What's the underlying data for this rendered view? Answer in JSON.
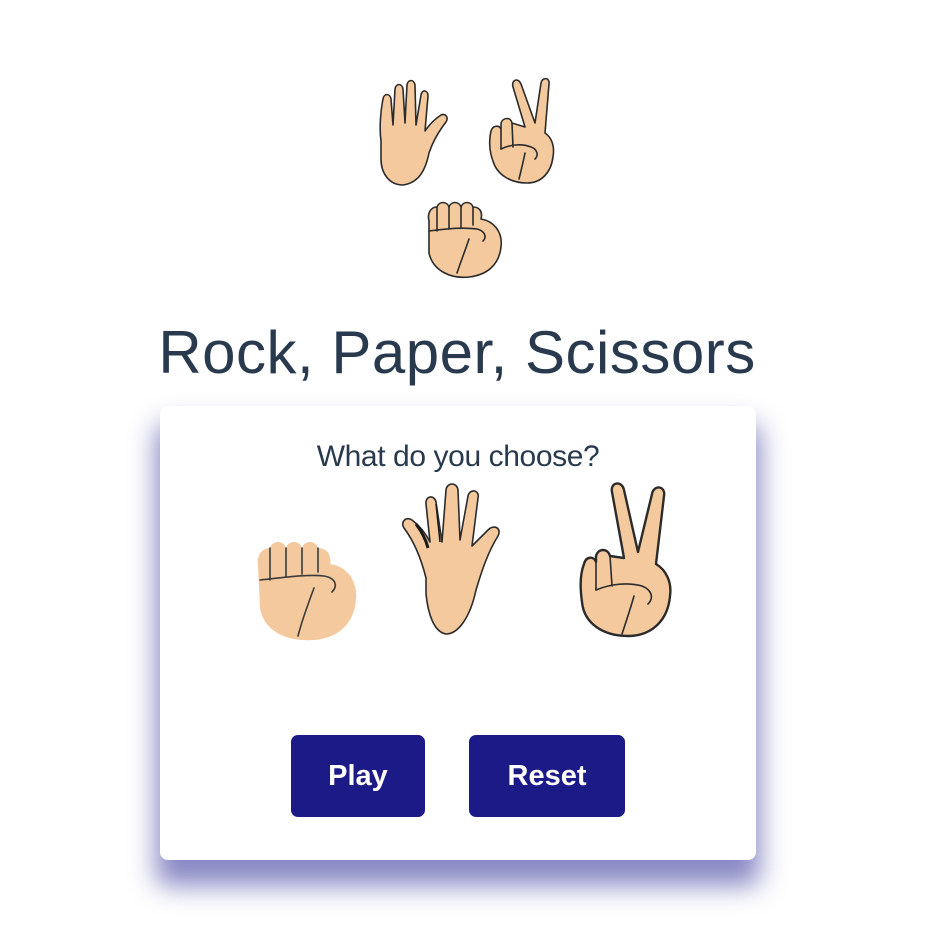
{
  "game": {
    "title": "Rock, Paper, Scissors",
    "prompt": "What do you choose?"
  },
  "choices": [
    {
      "name": "rock",
      "icon": "fist-icon"
    },
    {
      "name": "paper",
      "icon": "open-hand-icon"
    },
    {
      "name": "scissors",
      "icon": "victory-hand-icon"
    }
  ],
  "buttons": {
    "play_label": "Play",
    "reset_label": "Reset"
  },
  "colors": {
    "title_text": "#2a3a4e",
    "button_bg": "#1c1a87",
    "button_text": "#ffffff",
    "card_shadow": "#2828a0",
    "skin": "#f4c99d"
  }
}
